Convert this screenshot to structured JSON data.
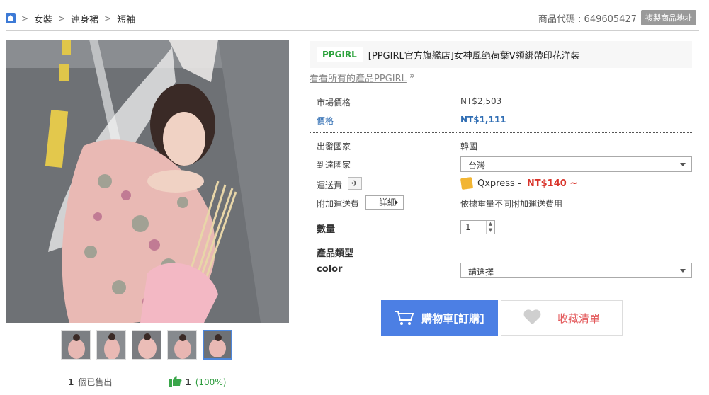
{
  "breadcrumb": {
    "items": [
      "女裝",
      "連身裙",
      "短袖"
    ],
    "separator": ">"
  },
  "product_code": {
    "label": "商品代碼 : 649605427",
    "copy_button": "複製商品地址"
  },
  "product": {
    "brand": "PPGIRL",
    "title": "[PPGIRL官方旗艦店]女神風範荷葉V領綁帶印花洋裝",
    "see_all": "看看所有的產品PPGIRL",
    "see_all_arrow": "»"
  },
  "pricing": {
    "market_label": "市場價格",
    "market_value": "NT$2,503",
    "price_label": "價格",
    "price_value": "NT$1,111"
  },
  "shipping": {
    "origin_label": "出發國家",
    "origin_value": "韓國",
    "dest_label": "到達國家",
    "dest_value": "台灣",
    "fee_label": "運送費",
    "carrier": "Qxpress -",
    "fee_value": "NT$140 ~",
    "extra_label": "附加運送費",
    "detail_button": "詳細",
    "extra_note": "依據重量不同附加運送費用"
  },
  "order": {
    "qty_label": "數量",
    "qty_value": "1",
    "type_label": "產品類型",
    "color_label": "color",
    "color_placeholder": "請選擇"
  },
  "actions": {
    "cart_button": "購物車[訂購]",
    "fav_button": "收藏清單"
  },
  "stats": {
    "sold_count": "1",
    "sold_label": "個已售出",
    "likes": "1",
    "likes_pct": "(100%)"
  },
  "colors": {
    "accent_blue": "#4c7fe4",
    "price_blue": "#2f6db3",
    "brand_green": "#2aa13a",
    "shipping_red": "#d9342b"
  }
}
